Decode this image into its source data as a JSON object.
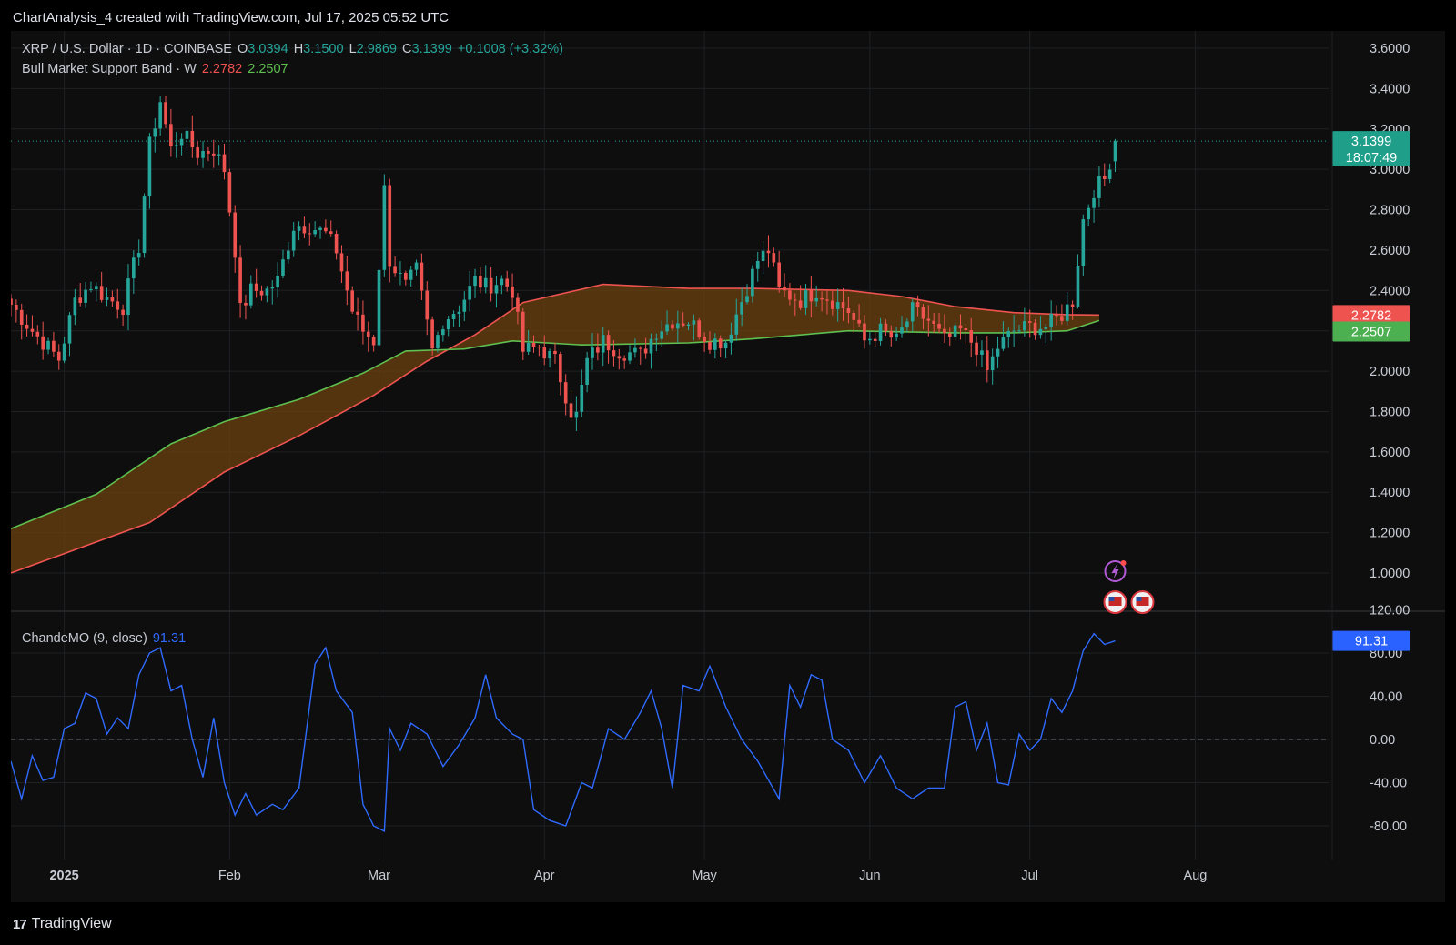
{
  "header": {
    "title": "ChartAnalysis_4 created with TradingView.com, Jul 17, 2025 05:52 UTC"
  },
  "legend": {
    "symbol": "XRP / U.S. Dollar · 1D · COINBASE",
    "open_label": "O",
    "open": "3.0394",
    "high_label": "H",
    "high": "3.1500",
    "low_label": "L",
    "low": "2.9869",
    "close_label": "C",
    "close": "3.1399",
    "change": "+0.1008 (+3.32%)",
    "indicator_name": "Bull Market Support Band · W",
    "band_upper": "2.2782",
    "band_lower": "2.2507",
    "osc_name": "ChandeMO (9, close)",
    "osc_value": "91.31"
  },
  "badges": {
    "price": "3.1399",
    "countdown": "18:07:49",
    "band_upper": "2.2782",
    "band_lower": "2.2507",
    "osc": "91.31"
  },
  "colors": {
    "up": "#26a69a",
    "down": "#ef5350",
    "band_upper": "#ef5350",
    "band_lower": "#5fbf4f",
    "band_fill": "#6b4210",
    "osc_line": "#2f6bff",
    "background": "#0e0e0f",
    "grid": "#1f2023"
  },
  "footer": {
    "brand": "TradingView"
  },
  "chart_data": [
    {
      "type": "candlestick",
      "title": "XRP / U.S. Dollar · 1D · COINBASE",
      "ylim": [
        0.86,
        3.68
      ],
      "y_ticks": [
        "3.6000",
        "3.4000",
        "3.2000",
        "3.0000",
        "2.8000",
        "2.6000",
        "2.4000",
        "2.2000",
        "2.0000",
        "1.8000",
        "1.6000",
        "1.4000",
        "1.2000",
        "1.0000"
      ],
      "x_ticks": [
        "2025",
        "Feb",
        "Mar",
        "Apr",
        "May",
        "Jun",
        "Jul",
        "Aug"
      ],
      "x_range": [
        "2024-12-22",
        "2025-08-26"
      ],
      "last_price": 3.1399,
      "close_path": [
        [
          "2024-12-22",
          2.33
        ],
        [
          "2024-12-26",
          2.2
        ],
        [
          "2024-12-31",
          2.06
        ],
        [
          "2025-01-03",
          2.35
        ],
        [
          "2025-01-06",
          2.43
        ],
        [
          "2025-01-09",
          2.36
        ],
        [
          "2025-01-12",
          2.32
        ],
        [
          "2025-01-15",
          2.62
        ],
        [
          "2025-01-17",
          3.12
        ],
        [
          "2025-01-19",
          3.34
        ],
        [
          "2025-01-21",
          3.1
        ],
        [
          "2025-01-23",
          3.18
        ],
        [
          "2025-01-26",
          3.08
        ],
        [
          "2025-01-29",
          3.1
        ],
        [
          "2025-01-31",
          3.0
        ],
        [
          "2025-02-02",
          2.6
        ],
        [
          "2025-02-03",
          2.3
        ],
        [
          "2025-02-05",
          2.4
        ],
        [
          "2025-02-08",
          2.4
        ],
        [
          "2025-02-10",
          2.45
        ],
        [
          "2025-02-13",
          2.72
        ],
        [
          "2025-02-16",
          2.72
        ],
        [
          "2025-02-19",
          2.68
        ],
        [
          "2025-02-21",
          2.6
        ],
        [
          "2025-02-24",
          2.3
        ],
        [
          "2025-02-26",
          2.2
        ],
        [
          "2025-02-28",
          2.15
        ],
        [
          "2025-03-02",
          2.9
        ],
        [
          "2025-03-03",
          2.55
        ],
        [
          "2025-03-06",
          2.42
        ],
        [
          "2025-03-08",
          2.5
        ],
        [
          "2025-03-11",
          2.1
        ],
        [
          "2025-03-13",
          2.25
        ],
        [
          "2025-03-16",
          2.32
        ],
        [
          "2025-03-19",
          2.45
        ],
        [
          "2025-03-21",
          2.42
        ],
        [
          "2025-03-24",
          2.45
        ],
        [
          "2025-03-26",
          2.4
        ],
        [
          "2025-03-28",
          2.1
        ],
        [
          "2025-03-31",
          2.12
        ],
        [
          "2025-04-03",
          2.05
        ],
        [
          "2025-04-06",
          1.8
        ],
        [
          "2025-04-07",
          1.78
        ],
        [
          "2025-04-09",
          2.05
        ],
        [
          "2025-04-12",
          2.15
        ],
        [
          "2025-04-15",
          2.1
        ],
        [
          "2025-04-19",
          2.08
        ],
        [
          "2025-04-22",
          2.2
        ],
        [
          "2025-04-25",
          2.25
        ],
        [
          "2025-04-28",
          2.25
        ],
        [
          "2025-05-02",
          2.15
        ],
        [
          "2025-05-05",
          2.15
        ],
        [
          "2025-05-08",
          2.35
        ],
        [
          "2025-05-11",
          2.55
        ],
        [
          "2025-05-13",
          2.6
        ],
        [
          "2025-05-15",
          2.4
        ],
        [
          "2025-05-19",
          2.35
        ],
        [
          "2025-05-22",
          2.4
        ],
        [
          "2025-05-25",
          2.35
        ],
        [
          "2025-05-28",
          2.3
        ],
        [
          "2025-05-31",
          2.15
        ],
        [
          "2025-06-03",
          2.2
        ],
        [
          "2025-06-06",
          2.15
        ],
        [
          "2025-06-09",
          2.3
        ],
        [
          "2025-06-12",
          2.25
        ],
        [
          "2025-06-15",
          2.15
        ],
        [
          "2025-06-18",
          2.2
        ],
        [
          "2025-06-21",
          2.12
        ],
        [
          "2025-06-23",
          2.0
        ],
        [
          "2025-06-25",
          2.12
        ],
        [
          "2025-06-28",
          2.2
        ],
        [
          "2025-07-01",
          2.22
        ],
        [
          "2025-07-04",
          2.22
        ],
        [
          "2025-07-07",
          2.28
        ],
        [
          "2025-07-09",
          2.35
        ],
        [
          "2025-07-10",
          2.55
        ],
        [
          "2025-07-11",
          2.75
        ],
        [
          "2025-07-13",
          2.9
        ],
        [
          "2025-07-15",
          2.95
        ],
        [
          "2025-07-16",
          3.04
        ],
        [
          "2025-07-17",
          3.14
        ]
      ],
      "band": {
        "upper": [
          [
            "2024-12-22",
            1.0
          ],
          [
            "2025-01-17",
            1.25
          ],
          [
            "2025-01-31",
            1.5
          ],
          [
            "2025-02-14",
            1.68
          ],
          [
            "2025-02-28",
            1.88
          ],
          [
            "2025-03-10",
            2.05
          ],
          [
            "2025-03-19",
            2.18
          ],
          [
            "2025-03-28",
            2.34
          ],
          [
            "2025-04-12",
            2.43
          ],
          [
            "2025-04-28",
            2.41
          ],
          [
            "2025-05-10",
            2.41
          ],
          [
            "2025-05-28",
            2.4
          ],
          [
            "2025-06-07",
            2.37
          ],
          [
            "2025-06-17",
            2.32
          ],
          [
            "2025-06-28",
            2.29
          ],
          [
            "2025-07-08",
            2.28
          ],
          [
            "2025-07-14",
            2.2782
          ]
        ],
        "lower": [
          [
            "2024-12-22",
            1.22
          ],
          [
            "2025-01-07",
            1.39
          ],
          [
            "2025-01-21",
            1.64
          ],
          [
            "2025-01-31",
            1.75
          ],
          [
            "2025-02-14",
            1.86
          ],
          [
            "2025-02-26",
            1.99
          ],
          [
            "2025-03-06",
            2.1
          ],
          [
            "2025-03-17",
            2.11
          ],
          [
            "2025-03-26",
            2.15
          ],
          [
            "2025-04-08",
            2.13
          ],
          [
            "2025-04-28",
            2.14
          ],
          [
            "2025-05-10",
            2.16
          ],
          [
            "2025-05-28",
            2.2
          ],
          [
            "2025-06-17",
            2.19
          ],
          [
            "2025-06-28",
            2.19
          ],
          [
            "2025-07-08",
            2.2
          ],
          [
            "2025-07-14",
            2.2507
          ]
        ]
      }
    },
    {
      "type": "line",
      "title": "ChandeMO (9, close)",
      "ylim": [
        -120,
        120
      ],
      "y_ticks": [
        "120.00",
        "80.00",
        "40.00",
        "0.00",
        "-40.00",
        "-80.00"
      ],
      "last_value": 91.31,
      "series": [
        {
          "name": "ChandeMO (9, close)",
          "values": [
            [
              "2024-12-22",
              -20
            ],
            [
              "2024-12-24",
              -55
            ],
            [
              "2024-12-26",
              -15
            ],
            [
              "2024-12-28",
              -38
            ],
            [
              "2024-12-30",
              -35
            ],
            [
              "2025-01-01",
              10
            ],
            [
              "2025-01-03",
              15
            ],
            [
              "2025-01-05",
              43
            ],
            [
              "2025-01-07",
              38
            ],
            [
              "2025-01-09",
              5
            ],
            [
              "2025-01-11",
              20
            ],
            [
              "2025-01-13",
              10
            ],
            [
              "2025-01-15",
              60
            ],
            [
              "2025-01-17",
              80
            ],
            [
              "2025-01-19",
              85
            ],
            [
              "2025-01-21",
              45
            ],
            [
              "2025-01-23",
              50
            ],
            [
              "2025-01-25",
              0
            ],
            [
              "2025-01-27",
              -35
            ],
            [
              "2025-01-29",
              20
            ],
            [
              "2025-01-31",
              -40
            ],
            [
              "2025-02-02",
              -70
            ],
            [
              "2025-02-04",
              -50
            ],
            [
              "2025-02-06",
              -70
            ],
            [
              "2025-02-09",
              -60
            ],
            [
              "2025-02-11",
              -65
            ],
            [
              "2025-02-14",
              -45
            ],
            [
              "2025-02-17",
              70
            ],
            [
              "2025-02-19",
              85
            ],
            [
              "2025-02-21",
              45
            ],
            [
              "2025-02-24",
              25
            ],
            [
              "2025-02-26",
              -60
            ],
            [
              "2025-02-28",
              -80
            ],
            [
              "2025-03-02",
              -85
            ],
            [
              "2025-03-03",
              10
            ],
            [
              "2025-03-05",
              -10
            ],
            [
              "2025-03-07",
              15
            ],
            [
              "2025-03-10",
              5
            ],
            [
              "2025-03-13",
              -25
            ],
            [
              "2025-03-16",
              -5
            ],
            [
              "2025-03-19",
              20
            ],
            [
              "2025-03-21",
              60
            ],
            [
              "2025-03-23",
              20
            ],
            [
              "2025-03-26",
              5
            ],
            [
              "2025-03-28",
              0
            ],
            [
              "2025-03-30",
              -65
            ],
            [
              "2025-04-02",
              -75
            ],
            [
              "2025-04-05",
              -80
            ],
            [
              "2025-04-08",
              -40
            ],
            [
              "2025-04-10",
              -45
            ],
            [
              "2025-04-13",
              10
            ],
            [
              "2025-04-16",
              0
            ],
            [
              "2025-04-19",
              25
            ],
            [
              "2025-04-21",
              45
            ],
            [
              "2025-04-23",
              10
            ],
            [
              "2025-04-25",
              -45
            ],
            [
              "2025-04-27",
              50
            ],
            [
              "2025-04-30",
              45
            ],
            [
              "2025-05-02",
              68
            ],
            [
              "2025-05-05",
              30
            ],
            [
              "2025-05-08",
              0
            ],
            [
              "2025-05-11",
              -20
            ],
            [
              "2025-05-15",
              -55
            ],
            [
              "2025-05-17",
              50
            ],
            [
              "2025-05-19",
              30
            ],
            [
              "2025-05-21",
              60
            ],
            [
              "2025-05-23",
              55
            ],
            [
              "2025-05-25",
              0
            ],
            [
              "2025-05-28",
              -10
            ],
            [
              "2025-05-31",
              -40
            ],
            [
              "2025-06-03",
              -15
            ],
            [
              "2025-06-06",
              -45
            ],
            [
              "2025-06-09",
              -55
            ],
            [
              "2025-06-12",
              -45
            ],
            [
              "2025-06-15",
              -45
            ],
            [
              "2025-06-17",
              30
            ],
            [
              "2025-06-19",
              35
            ],
            [
              "2025-06-21",
              -10
            ],
            [
              "2025-06-23",
              15
            ],
            [
              "2025-06-25",
              -40
            ],
            [
              "2025-06-27",
              -42
            ],
            [
              "2025-06-29",
              5
            ],
            [
              "2025-07-01",
              -10
            ],
            [
              "2025-07-03",
              0
            ],
            [
              "2025-07-05",
              38
            ],
            [
              "2025-07-07",
              25
            ],
            [
              "2025-07-09",
              45
            ],
            [
              "2025-07-11",
              82
            ],
            [
              "2025-07-13",
              98
            ],
            [
              "2025-07-15",
              88
            ],
            [
              "2025-07-17",
              91.31
            ]
          ]
        }
      ]
    }
  ]
}
